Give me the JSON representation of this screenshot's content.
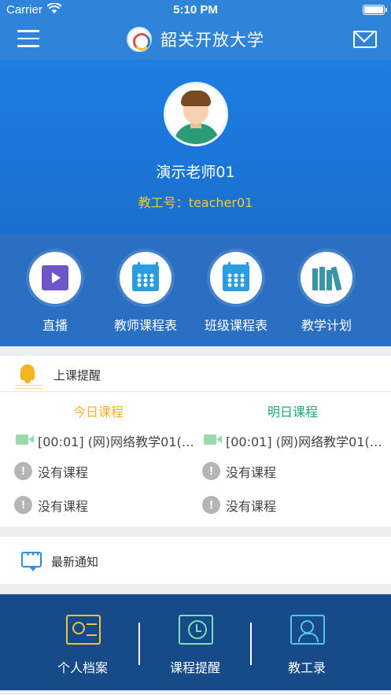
{
  "status_bar": {
    "carrier": "Carrier",
    "time": "5:10 PM"
  },
  "nav": {
    "title": "韶关开放大学"
  },
  "profile": {
    "name": "演示老师01",
    "id_label": "教工号：",
    "id_value": "teacher01"
  },
  "quick_menu": [
    {
      "label": "直播",
      "icon": "play-icon"
    },
    {
      "label": "教师课程表",
      "icon": "calendar-icon"
    },
    {
      "label": "班级课程表",
      "icon": "calendar-icon"
    },
    {
      "label": "教学计划",
      "icon": "books-icon"
    }
  ],
  "reminder": {
    "title": "上课提醒",
    "today": {
      "header": "今日课程",
      "header_color": "#f0b429",
      "items": [
        "[00:01] (网)网络教学01(…",
        "没有课程",
        "没有课程"
      ]
    },
    "tomorrow": {
      "header": "明日课程",
      "header_color": "#1fa87a",
      "items": [
        "[00:01] (网)网络教学01(…",
        "没有课程",
        "没有课程"
      ]
    }
  },
  "notice": {
    "title": "最新通知"
  },
  "bottom_menu": [
    {
      "label": "个人档案",
      "icon": "id-card-icon"
    },
    {
      "label": "课程提醒",
      "icon": "alarm-clock-icon"
    },
    {
      "label": "教工录",
      "icon": "staff-directory-icon"
    }
  ],
  "colors": {
    "primary": "#2f84d9",
    "quick_bg": "#2a6fc2",
    "bottom_bg": "#164a89",
    "id_text": "#f3c832"
  }
}
